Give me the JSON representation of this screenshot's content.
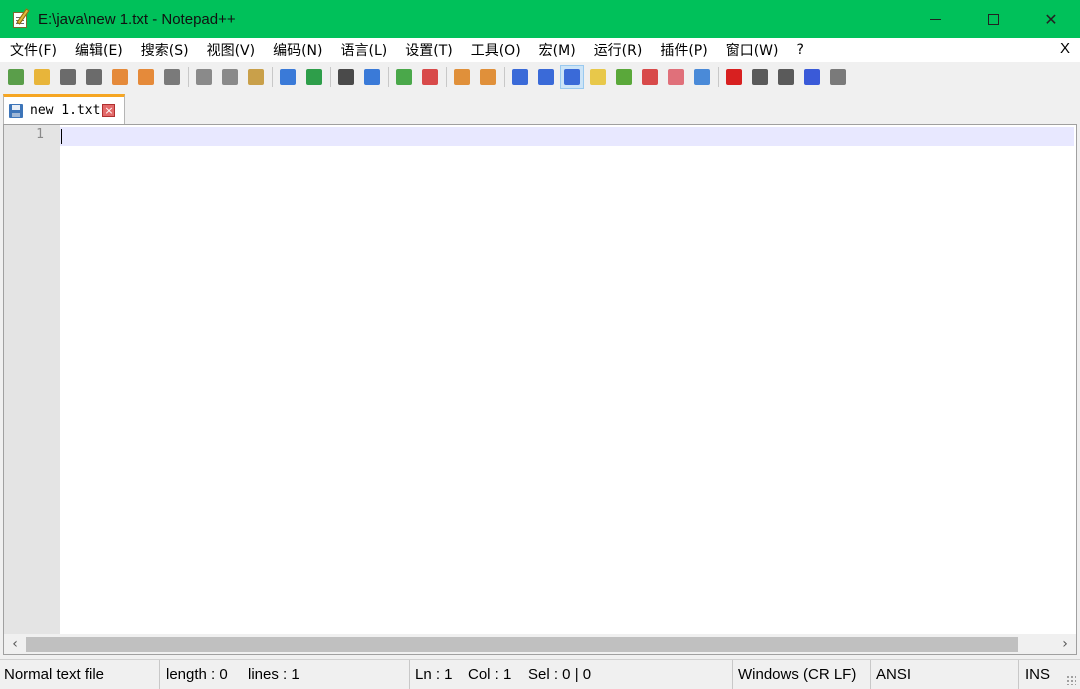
{
  "window": {
    "title": "E:\\java\\new 1.txt - Notepad++",
    "controls": {
      "minimize": "",
      "maximize": "",
      "close": "✕"
    }
  },
  "menu": {
    "items": [
      "文件(F)",
      "编辑(E)",
      "搜索(S)",
      "视图(V)",
      "编码(N)",
      "语言(L)",
      "设置(T)",
      "工具(O)",
      "宏(M)",
      "运行(R)",
      "插件(P)",
      "窗口(W)",
      "?"
    ],
    "close": "X"
  },
  "toolbar": {
    "buttons": [
      {
        "name": "new-file-icon",
        "color": "#5a9e4a"
      },
      {
        "name": "open-file-icon",
        "color": "#e8b53a"
      },
      {
        "name": "save-icon",
        "color": "#6b6b6b"
      },
      {
        "name": "save-all-icon",
        "color": "#6b6b6b"
      },
      {
        "name": "close-file-icon",
        "color": "#e58a3a"
      },
      {
        "name": "close-all-icon",
        "color": "#e58a3a"
      },
      {
        "name": "print-icon",
        "color": "#7a7a7a"
      },
      {
        "name": "cut-icon",
        "color": "#8a8a8a"
      },
      {
        "name": "copy-icon",
        "color": "#8a8a8a"
      },
      {
        "name": "paste-icon",
        "color": "#c9a04a"
      },
      {
        "name": "undo-icon",
        "color": "#3a7ad8"
      },
      {
        "name": "redo-icon",
        "color": "#2e9e4a"
      },
      {
        "name": "find-icon",
        "color": "#4a4a4a"
      },
      {
        "name": "replace-icon",
        "color": "#3a7ad8"
      },
      {
        "name": "zoom-in-icon",
        "color": "#4aa84a"
      },
      {
        "name": "zoom-out-icon",
        "color": "#d84a4a"
      },
      {
        "name": "sync-vertical-icon",
        "color": "#e0903a"
      },
      {
        "name": "sync-horizontal-icon",
        "color": "#e0903a"
      },
      {
        "name": "word-wrap-icon",
        "color": "#3a6ad8"
      },
      {
        "name": "show-all-chars-icon",
        "color": "#3a6ad8"
      },
      {
        "name": "indent-guide-icon",
        "color": "#3a6ad8"
      },
      {
        "name": "user-defined-language-icon",
        "color": "#e8c84a"
      },
      {
        "name": "document-map-icon",
        "color": "#5aa83a"
      },
      {
        "name": "function-list-icon",
        "color": "#d84a4a"
      },
      {
        "name": "folder-as-workspace-icon",
        "color": "#e0707a"
      },
      {
        "name": "monitoring-icon",
        "color": "#4a8ad8"
      },
      {
        "name": "record-macro-icon",
        "color": "#d82020"
      },
      {
        "name": "stop-recording-icon",
        "color": "#5a5a5a"
      },
      {
        "name": "playback-macro-icon",
        "color": "#5a5a5a"
      },
      {
        "name": "run-macro-multiple-icon",
        "color": "#3a5ad8"
      },
      {
        "name": "save-macro-icon",
        "color": "#7a7a7a"
      }
    ]
  },
  "tabs": [
    {
      "label": "new 1.txt",
      "close": "×"
    }
  ],
  "editor": {
    "line_numbers": [
      "1"
    ]
  },
  "scrollbar": {
    "left": "‹",
    "right": "›"
  },
  "status": {
    "file_type": "Normal text file",
    "length": "length : 0",
    "lines": "lines : 1",
    "ln": "Ln : 1",
    "col": "Col : 1",
    "sel": "Sel : 0 | 0",
    "eol": "Windows (CR LF)",
    "encoding": "ANSI",
    "mode": "INS"
  }
}
